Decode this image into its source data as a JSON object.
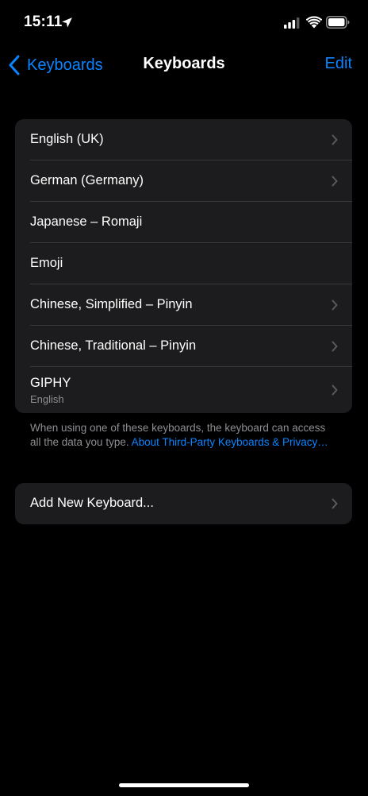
{
  "status_bar": {
    "time": "15:11"
  },
  "nav": {
    "back_label": "Keyboards",
    "title": "Keyboards",
    "edit_label": "Edit"
  },
  "keyboards": [
    {
      "label": "English (UK)",
      "sublabel": "",
      "has_chevron": true
    },
    {
      "label": "German (Germany)",
      "sublabel": "",
      "has_chevron": true
    },
    {
      "label": "Japanese – Romaji",
      "sublabel": "",
      "has_chevron": false
    },
    {
      "label": "Emoji",
      "sublabel": "",
      "has_chevron": false
    },
    {
      "label": "Chinese, Simplified – Pinyin",
      "sublabel": "",
      "has_chevron": true
    },
    {
      "label": "Chinese, Traditional – Pinyin",
      "sublabel": "",
      "has_chevron": true
    },
    {
      "label": "GIPHY",
      "sublabel": "English",
      "has_chevron": true
    }
  ],
  "footer": {
    "line1": "When using one of these keyboards, the keyboard can access",
    "line2": "all the data you type.",
    "link": "About Third-Party Keyboards & Privacy…"
  },
  "add_keyboard": {
    "label": "Add New Keyboard..."
  },
  "colors": {
    "background": "#000000",
    "cell": "#1c1c1e",
    "separator": "#38383a",
    "accent": "#0a84ff",
    "secondary_text": "#8e8e93",
    "chevron": "#5a5a5f"
  },
  "icons": {
    "location": "location-arrow-icon",
    "signal": "cellular-signal-icon",
    "wifi": "wifi-icon",
    "battery": "battery-icon",
    "back": "chevron-left-icon",
    "disclosure": "chevron-right-icon"
  }
}
